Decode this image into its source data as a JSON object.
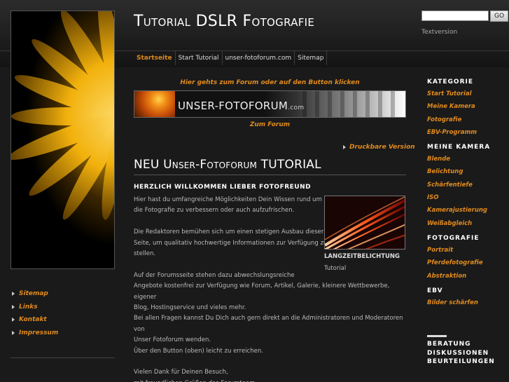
{
  "header": {
    "title_big_1": "T",
    "title_small_1": "UTORIAL",
    "title_big_2": "DSLR",
    "title_big_3": "F",
    "title_small_3": "OTOGRAFIE"
  },
  "search": {
    "value": "",
    "button_label": "GO"
  },
  "text_version": "Textversion",
  "nav": {
    "tabs": [
      {
        "label": "Startseite",
        "active": true
      },
      {
        "label": "Start Tutorial"
      },
      {
        "label": "unser-fotoforum.com"
      },
      {
        "label": "Sitemap"
      }
    ]
  },
  "left_nav": {
    "items": [
      {
        "label": "Sitemap"
      },
      {
        "label": "Links"
      },
      {
        "label": "Kontakt"
      },
      {
        "label": "Impressum"
      }
    ]
  },
  "main": {
    "forum_hint": "Hier gehts zum Forum oder auf den Button klicken",
    "banner_text": "UNSER-FOTOFORUM",
    "banner_suffix": ".com",
    "to_forum": "Zum Forum",
    "print_version": "Druckbare Version",
    "title_big_1": "NEU ",
    "title_big_2": "U",
    "title_small_2": "NSER",
    "title_dash_2": "-F",
    "title_small_3": "OTOFORUM",
    "title_big_4": " TUTORIAL",
    "welcome_heading": "HERZLICH WILLKOMMEN LIEBER FOTOFREUND",
    "paragraphs": [
      "Hier hast du umfangreiche Möglichkeiten Dein Wissen rund um\ndie Fotografie zu verbessern oder auch aufzufrischen.",
      "Die Redaktoren bemühen sich um einen stetigen Ausbau dieser\nSeite, um qualitativ hochwertige Informationen zur Verfügung zu\nstellen.",
      "Auf der Forumsseite stehen dazu abwechslungsreiche\nAngebote kostenfrei zur Verfügung wie Forum, Artikel, Galerie, kleinere Wettbewerbe, eigener\nBlog, Hostingservice und vieles mehr.\nBei allen Fragen kannst Du Dich auch gern direkt an die Administratoren und Moderatoren von\nUnser Fotoforum wenden.\nÜber den Button (oben) leicht zu erreichen.",
      "Vielen Dank für Deinen Besuch,\nmit freundlichen Grüßen das Forumteam"
    ],
    "image_caption": "LANGZEITBELICHTUNG",
    "image_sub": "Tutorial"
  },
  "sidebar": {
    "groups": [
      {
        "heading": "KATEGORIE",
        "links": [
          "Start Tutorial",
          "Meine Kamera",
          "Fotografie",
          "EBV-Programm"
        ]
      },
      {
        "heading": "MEINE KAMERA",
        "links": [
          "Blende",
          "Belichtung",
          "Schärfentiefe",
          "ISO",
          "Kamerajustierung",
          "Weißabgleich"
        ]
      },
      {
        "heading": "FOTOGRAFIE",
        "links": [
          "Portrait",
          "Pferdefotografie",
          "Abstraktion"
        ]
      },
      {
        "heading": "EBV",
        "links": [
          "Bilder schärfen"
        ]
      }
    ],
    "bottom_items": [
      "BERATUNG",
      "DISKUSSIONEN",
      "BEURTEILUNGEN"
    ]
  },
  "colors": {
    "accent": "#e08a1e",
    "background": "#1a1a1a",
    "text": "#bbbbbb"
  }
}
